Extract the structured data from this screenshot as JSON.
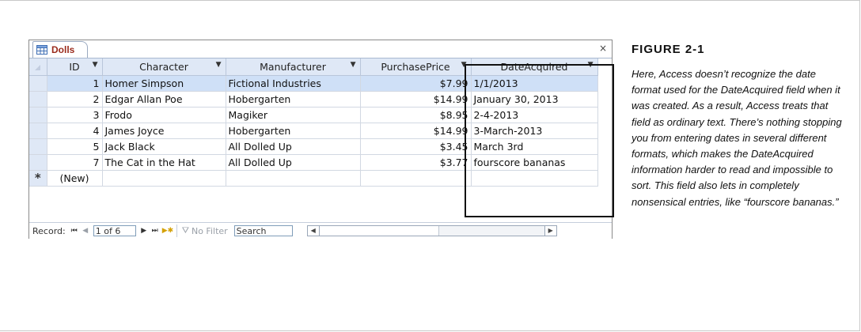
{
  "window": {
    "tab_label": "Dolls",
    "close_glyph": "×"
  },
  "table": {
    "columns": [
      {
        "label": "ID"
      },
      {
        "label": "Character"
      },
      {
        "label": "Manufacturer"
      },
      {
        "label": "PurchasePrice"
      },
      {
        "label": "DateAcquired"
      }
    ],
    "rows": [
      {
        "id": "1",
        "character": "Homer Simpson",
        "manufacturer": "Fictional Industries",
        "price": "$7.99",
        "date": "1/1/2013"
      },
      {
        "id": "2",
        "character": "Edgar Allan Poe",
        "manufacturer": "Hobergarten",
        "price": "$14.99",
        "date": "January 30, 2013"
      },
      {
        "id": "3",
        "character": "Frodo",
        "manufacturer": "Magiker",
        "price": "$8.95",
        "date": "2-4-2013"
      },
      {
        "id": "4",
        "character": "James Joyce",
        "manufacturer": "Hobergarten",
        "price": "$14.99",
        "date": "3-March-2013"
      },
      {
        "id": "5",
        "character": "Jack Black",
        "manufacturer": "All Dolled Up",
        "price": "$3.45",
        "date": "March 3rd"
      },
      {
        "id": "7",
        "character": "The Cat in the Hat",
        "manufacturer": "All Dolled Up",
        "price": "$3.77",
        "date": "fourscore bananas"
      }
    ],
    "new_row_marker": "*",
    "new_row_label": "(New)"
  },
  "navigation": {
    "record_label": "Record:",
    "record_position": "1 of 6",
    "filter_label": "No Filter",
    "search_label": "Search"
  },
  "figure": {
    "title": "FIGURE 2-1",
    "caption": "Here, Access doesn’t recognize the date format used for the DateAcquired field when it was created. As a result, Access treats that field as ordinary text. There’s nothing stopping you from entering dates in several different formats, which makes the DateAcquired information harder to read and impossible to sort. This field also lets in completely nonsensical entries, like “fourscore bananas.”"
  },
  "colors": {
    "header_bg": "#dfe8f6",
    "selected_row": "#cfe0f7",
    "tab_text": "#9a2b1c"
  }
}
